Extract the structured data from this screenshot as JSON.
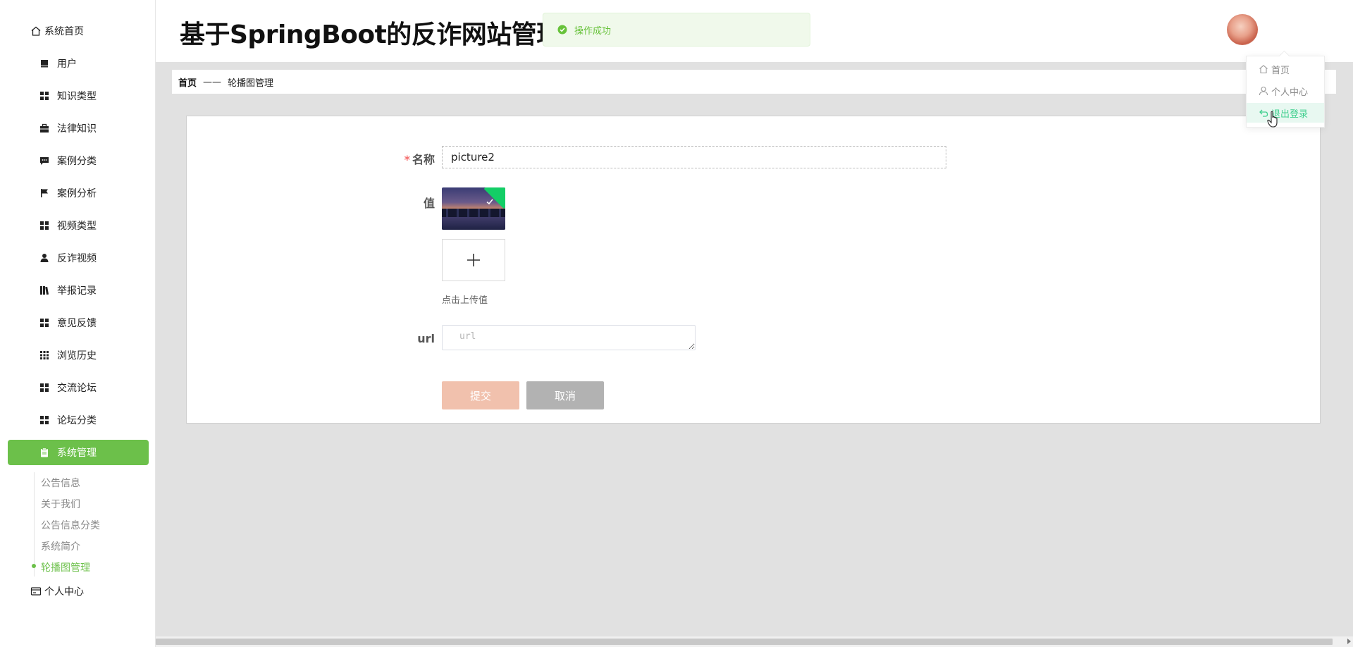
{
  "sidebar": {
    "items": [
      {
        "label": "系统首页",
        "icon": "home-icon"
      },
      {
        "label": "用户",
        "icon": "bookmark-icon"
      },
      {
        "label": "知识类型",
        "icon": "grid-icon"
      },
      {
        "label": "法律知识",
        "icon": "briefcase-icon"
      },
      {
        "label": "案例分类",
        "icon": "chat-icon"
      },
      {
        "label": "案例分析",
        "icon": "flag-icon"
      },
      {
        "label": "视频类型",
        "icon": "grid-icon"
      },
      {
        "label": "反诈视频",
        "icon": "user-icon"
      },
      {
        "label": "举报记录",
        "icon": "books-icon"
      },
      {
        "label": "意见反馈",
        "icon": "grid-icon"
      },
      {
        "label": "浏览历史",
        "icon": "apps-icon"
      },
      {
        "label": "交流论坛",
        "icon": "grid-icon"
      },
      {
        "label": "论坛分类",
        "icon": "grid-icon"
      },
      {
        "label": "系统管理",
        "icon": "clipboard-icon"
      },
      {
        "label": "个人中心",
        "icon": "wallet-icon"
      }
    ],
    "submenu": [
      "公告信息",
      "关于我们",
      "公告信息分类",
      "系统简介",
      "轮播图管理"
    ]
  },
  "header": {
    "title": "基于SpringBoot的反诈网站管理",
    "toast": "操作成功"
  },
  "breadcrumb": {
    "home": "首页",
    "separator": "——",
    "current": "轮播图管理"
  },
  "form": {
    "name_label": "名称",
    "required_mark": "*",
    "name_value": "picture2",
    "value_label": "值",
    "upload_tip": "点击上传值",
    "url_label": "url",
    "url_placeholder": "url",
    "submit": "提交",
    "cancel": "取消"
  },
  "dropdown": {
    "items": [
      {
        "label": "首页",
        "icon": "home-icon"
      },
      {
        "label": "个人中心",
        "icon": "user-icon"
      },
      {
        "label": "退出登录",
        "icon": "logout-icon"
      }
    ]
  },
  "colors": {
    "accent": "#6cc04a",
    "toast_bg": "#f0f9eb",
    "toast_text": "#67c23a",
    "submit": "#f1c1ad",
    "cancel": "#b2b2b2",
    "hover_text": "#3fcf8e"
  }
}
